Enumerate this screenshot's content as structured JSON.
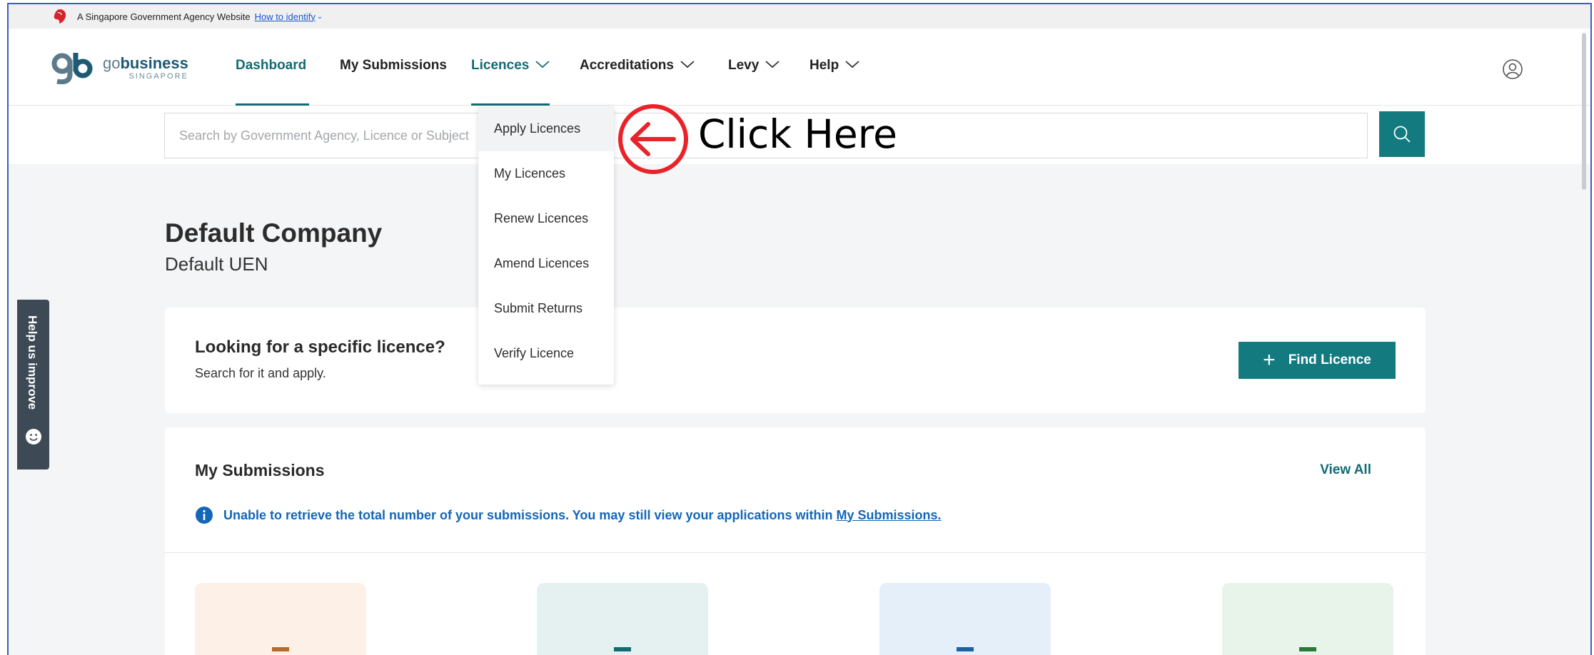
{
  "masthead": {
    "text": "A Singapore Government Agency Website",
    "link": "How to identify"
  },
  "logo": {
    "go": "go",
    "business": "business",
    "singapore": "SINGAPORE"
  },
  "nav": {
    "items": [
      {
        "label": "Dashboard"
      },
      {
        "label": "My Submissions"
      },
      {
        "label": "Licences"
      },
      {
        "label": "Accreditations"
      },
      {
        "label": "Levy"
      },
      {
        "label": "Help"
      }
    ]
  },
  "search": {
    "placeholder": "Search by Government Agency, Licence or Subject",
    "value": ""
  },
  "dropdown": {
    "items": [
      {
        "label": "Apply Licences"
      },
      {
        "label": "My Licences"
      },
      {
        "label": "Renew Licences"
      },
      {
        "label": "Amend Licences"
      },
      {
        "label": "Submit Returns"
      },
      {
        "label": "Verify Licence"
      }
    ]
  },
  "annotation": {
    "text": "Click Here",
    "color": "#e8232a"
  },
  "company": {
    "name": "Default Company",
    "uen": "Default UEN"
  },
  "find_card": {
    "title": "Looking for a specific licence?",
    "subtitle": "Search for it and apply.",
    "button": "Find Licence"
  },
  "submissions_card": {
    "title": "My Submissions",
    "view_all": "View All",
    "info_text": "Unable to retrieve the total number of your submissions. You may still view your applications within ",
    "info_link": "My Submissions.",
    "tiles": [
      {
        "bg": "#fdf1e7",
        "dash": "#b86a2a"
      },
      {
        "bg": "#e5f1f1",
        "dash": "#156b70"
      },
      {
        "bg": "#e5effa",
        "dash": "#1f5fa8"
      },
      {
        "bg": "#e8f3ea",
        "dash": "#2b7a3a"
      }
    ]
  },
  "feedback": {
    "label": "Help us improve"
  },
  "colors": {
    "brand": "#137a7f",
    "link": "#1366b8"
  }
}
